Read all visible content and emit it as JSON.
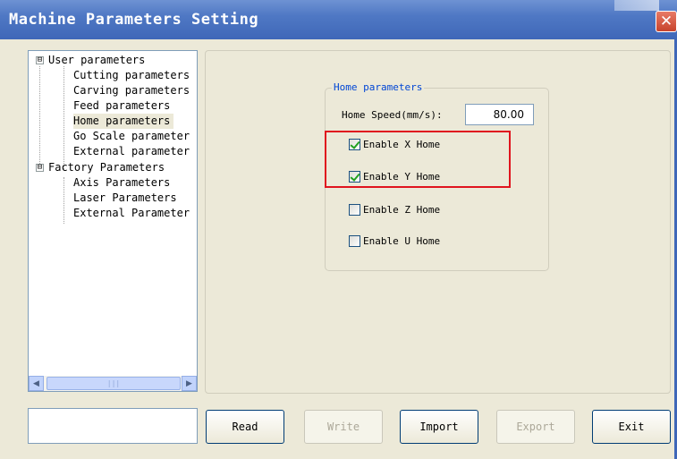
{
  "window": {
    "title": "Machine Parameters Setting",
    "close_symbol": "✕"
  },
  "tree": {
    "nodes": [
      {
        "label": "User parameters",
        "expander": "⊟"
      },
      {
        "label": "Cutting parameters"
      },
      {
        "label": "Carving parameters"
      },
      {
        "label": "Feed parameters"
      },
      {
        "label": "Home parameters",
        "selected": true
      },
      {
        "label": "Go Scale parameter"
      },
      {
        "label": "External parameter"
      },
      {
        "label": "Factory Parameters",
        "expander": "⊟"
      },
      {
        "label": "Axis Parameters"
      },
      {
        "label": "Laser Parameters"
      },
      {
        "label": "External Parameter"
      }
    ],
    "scroll": {
      "left_arrow": "◀",
      "right_arrow": "▶",
      "grip": "|||"
    }
  },
  "home_group": {
    "title": "Home parameters",
    "speed_label": "Home Speed(mm/s):",
    "speed_value": "80.00",
    "checkboxes": [
      {
        "label": "Enable X Home",
        "checked": true
      },
      {
        "label": "Enable Y Home",
        "checked": true
      },
      {
        "label": "Enable Z Home",
        "checked": false
      },
      {
        "label": "Enable U Home",
        "checked": false
      }
    ]
  },
  "buttons": {
    "read": "Read",
    "write": "Write",
    "import": "Import",
    "export": "Export",
    "exit": "Exit"
  },
  "status_text": ""
}
